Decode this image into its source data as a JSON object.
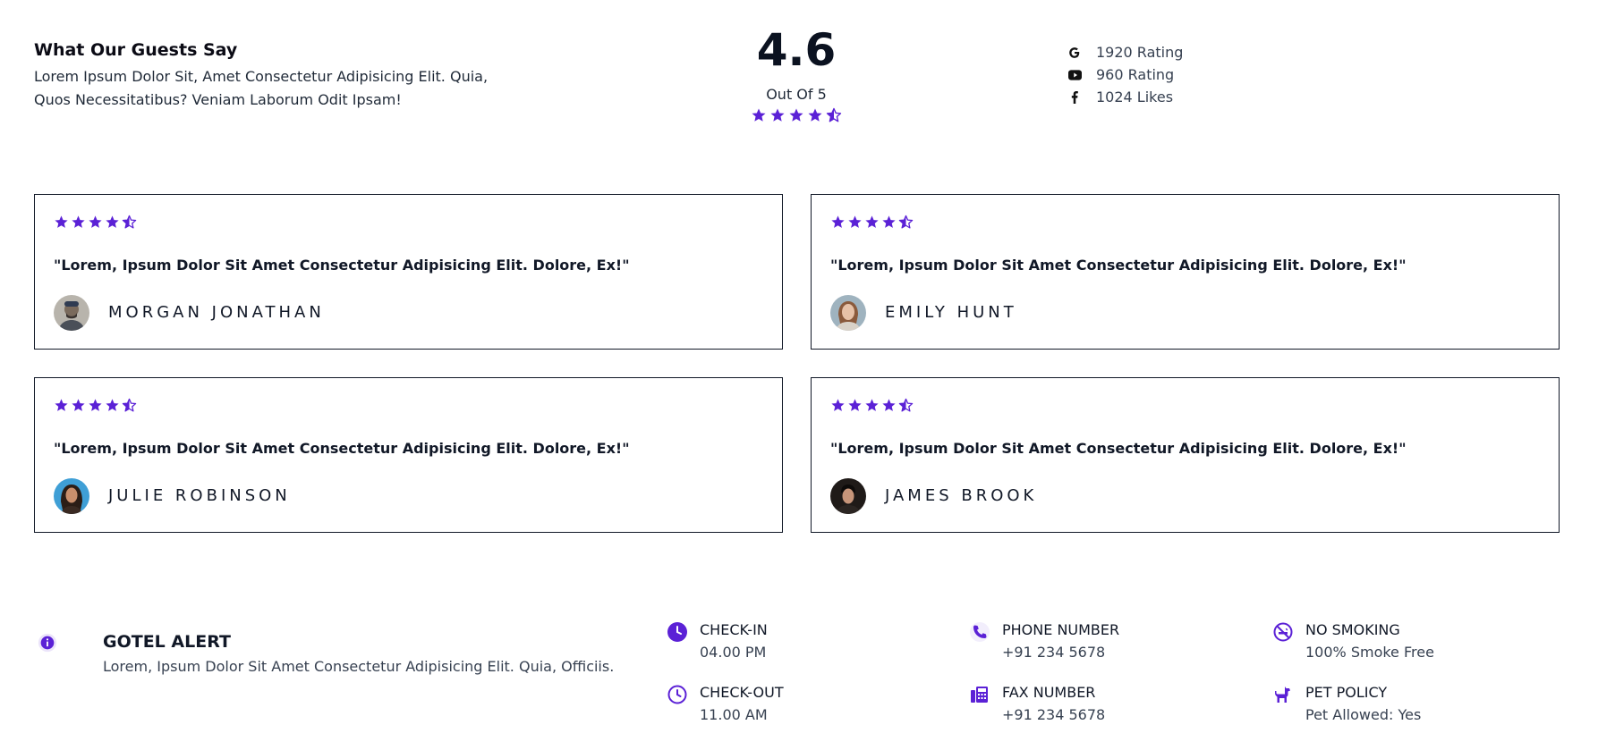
{
  "header": {
    "title": "What Our Guests Say",
    "description": "Lorem Ipsum Dolor Sit, Amet Consectetur Adipisicing Elit. Quia, Quos Necessitatibus? Veniam Laborum Odit Ipsam!",
    "rating_value": "4.6",
    "rating_out_of": "Out Of 5",
    "rating_stars": 4.5,
    "social": [
      {
        "icon": "google-icon",
        "text": "1920 Rating"
      },
      {
        "icon": "youtube-icon",
        "text": "960 Rating"
      },
      {
        "icon": "facebook-icon",
        "text": "1024 Likes"
      }
    ]
  },
  "reviews": [
    {
      "stars": 4.5,
      "quote": "\"Lorem, Ipsum Dolor Sit Amet Consectetur Adipisicing Elit. Dolore, Ex!\"",
      "name": "MORGAN JONATHAN"
    },
    {
      "stars": 4.5,
      "quote": "\"Lorem, Ipsum Dolor Sit Amet Consectetur Adipisicing Elit. Dolore, Ex!\"",
      "name": "EMILY HUNT"
    },
    {
      "stars": 4.5,
      "quote": "\"Lorem, Ipsum Dolor Sit Amet Consectetur Adipisicing Elit. Dolore, Ex!\"",
      "name": "JULIE ROBINSON"
    },
    {
      "stars": 4.5,
      "quote": "\"Lorem, Ipsum Dolor Sit Amet Consectetur Adipisicing Elit. Dolore, Ex!\"",
      "name": "JAMES BROOK"
    }
  ],
  "alert": {
    "title": "GOTEL ALERT",
    "description": "Lorem, Ipsum Dolor Sit Amet Consectetur Adipisicing Elit. Quia, Officiis."
  },
  "info": [
    {
      "icon": "clock-filled-icon",
      "label": "CHECK-IN",
      "value": "04.00 PM"
    },
    {
      "icon": "clock-outline-icon",
      "label": "CHECK-OUT",
      "value": "11.00 AM"
    },
    {
      "icon": "phone-icon",
      "label": "PHONE NUMBER",
      "value": "+91 234 5678"
    },
    {
      "icon": "fax-icon",
      "label": "FAX NUMBER",
      "value": "+91 234 5678"
    },
    {
      "icon": "no-smoking-icon",
      "label": "NO SMOKING",
      "value": "100% Smoke Free"
    },
    {
      "icon": "dog-icon",
      "label": "PET POLICY",
      "value": "Pet Allowed: Yes"
    }
  ],
  "colors": {
    "accent": "#5b21d6",
    "text": "#111827"
  }
}
